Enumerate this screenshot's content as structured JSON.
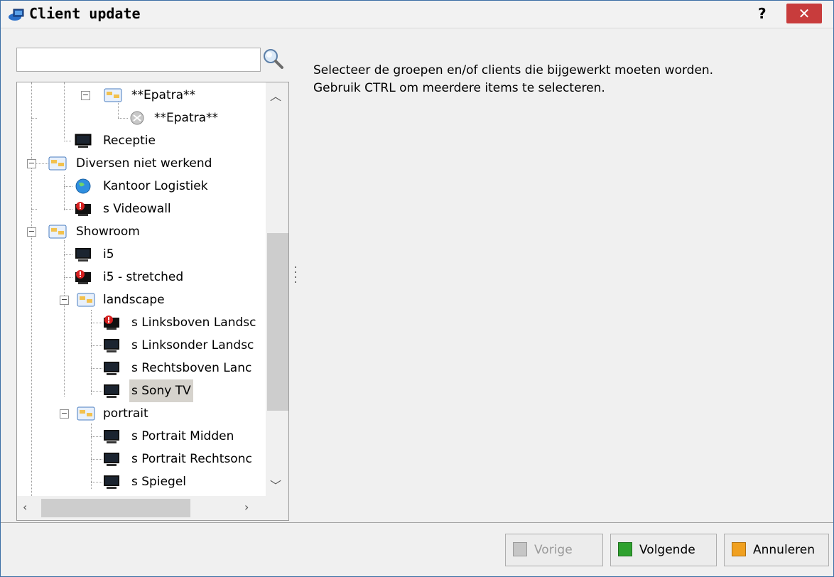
{
  "window": {
    "title": "Client update",
    "help_label": "?",
    "close_label": "✕"
  },
  "search": {
    "value": "",
    "placeholder": ""
  },
  "instructions": {
    "line1": "Selecteer de groepen en/of clients die bijgewerkt moeten worden.",
    "line2": "Gebruik CTRL om meerdere items te selecteren."
  },
  "tree": {
    "items": [
      {
        "label": "**Epatra**",
        "type": "group",
        "expanded": true
      },
      {
        "label": "**Epatra**",
        "type": "client-offline"
      },
      {
        "label": "Receptie",
        "type": "client"
      },
      {
        "label": "Diversen niet werkend",
        "type": "group",
        "expanded": true
      },
      {
        "label": "Kantoor Logistiek",
        "type": "client-web"
      },
      {
        "label": "s Videowall",
        "type": "client-error"
      },
      {
        "label": "Showroom",
        "type": "group",
        "expanded": true
      },
      {
        "label": "i5",
        "type": "client"
      },
      {
        "label": "i5 - stretched",
        "type": "client-error"
      },
      {
        "label": "landscape",
        "type": "group",
        "expanded": true
      },
      {
        "label": "s Linksboven Landsc",
        "type": "client-error"
      },
      {
        "label": "s Linksonder Landsc",
        "type": "client"
      },
      {
        "label": "s Rechtsboven Lanc",
        "type": "client"
      },
      {
        "label": "s Sony TV",
        "type": "client",
        "selected": true
      },
      {
        "label": "portrait",
        "type": "group",
        "expanded": true
      },
      {
        "label": "s Portrait Midden",
        "type": "client"
      },
      {
        "label": "s Portrait Rechtsonc",
        "type": "client"
      },
      {
        "label": "s Spiegel",
        "type": "client"
      }
    ]
  },
  "buttons": {
    "previous": "Vorige",
    "next": "Volgende",
    "cancel": "Annuleren"
  },
  "colors": {
    "close_bg": "#c83c3c",
    "selected_bg": "#d6d3cd",
    "next_icon": "#2fa12f",
    "cancel_icon": "#f0a020"
  }
}
